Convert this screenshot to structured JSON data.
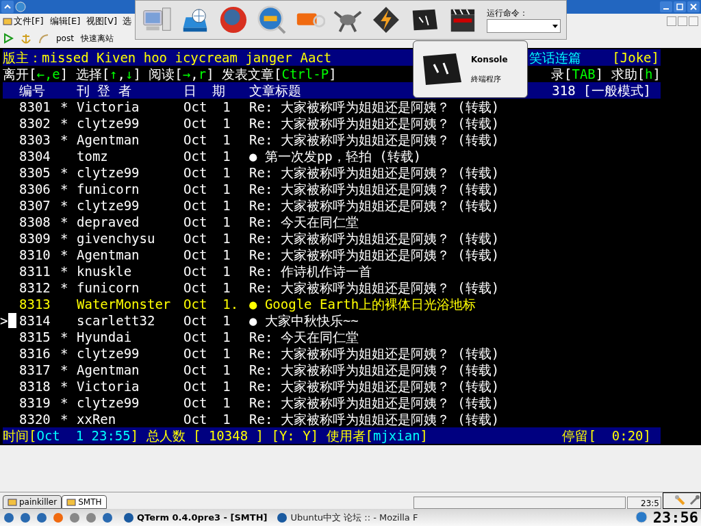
{
  "menu": [
    "文件[F]",
    "编辑[E]",
    "视图[V]",
    "选"
  ],
  "toolbar": [
    "post",
    "快速离站"
  ],
  "launcher": {
    "run_label": "运行命令："
  },
  "tooltip": {
    "title": "Konsole",
    "subtitle": "終端程序"
  },
  "terminal": {
    "cursor": ">",
    "header_left": [
      {
        "text": "版主：missed Kiven hoo icycream janger Aact",
        "kind": "label"
      }
    ],
    "header_right": [
      {
        "text": "笑话连篇",
        "kind": "value"
      },
      {
        "text": "    [Joke]",
        "kind": "label"
      }
    ],
    "help_left": [
      {
        "text": "离开[",
        "kind": "plain"
      },
      {
        "text": "←,e",
        "kind": "key"
      },
      {
        "text": "] 选择[",
        "kind": "plain"
      },
      {
        "text": "↑",
        "kind": "key"
      },
      {
        "text": ",",
        "kind": "plain"
      },
      {
        "text": "↓",
        "kind": "key"
      },
      {
        "text": "] 阅读[",
        "kind": "plain"
      },
      {
        "text": "→",
        "kind": "key"
      },
      {
        "text": ",",
        "kind": "plain"
      },
      {
        "text": "r",
        "kind": "key"
      },
      {
        "text": "] 发表文章[",
        "kind": "plain"
      },
      {
        "text": "Ctrl-P",
        "kind": "key"
      },
      {
        "text": "]",
        "kind": "plain"
      }
    ],
    "help_right": [
      {
        "text": "录[",
        "kind": "plain"
      },
      {
        "text": "TAB",
        "kind": "key"
      },
      {
        "text": "] 求助[",
        "kind": "plain"
      },
      {
        "text": "h",
        "kind": "key"
      },
      {
        "text": "]",
        "kind": "plain"
      }
    ],
    "columns": [
      "编号",
      "刊 登 者",
      "日  期",
      "文章标题"
    ],
    "columns_right": "318 [一般模式]",
    "rows": [
      {
        "number": "8301",
        "mark": "*",
        "author": "Victoria",
        "date": "Oct  1",
        "title": "Re: 大家被称呼为姐姐还是阿姨？ (转载)",
        "highlighted": false,
        "selected": false
      },
      {
        "number": "8302",
        "mark": "*",
        "author": "clytze99",
        "date": "Oct  1",
        "title": "Re: 大家被称呼为姐姐还是阿姨？ (转载)",
        "highlighted": false,
        "selected": false
      },
      {
        "number": "8303",
        "mark": "*",
        "author": "Agentman",
        "date": "Oct  1",
        "title": "Re: 大家被称呼为姐姐还是阿姨？ (转载)",
        "highlighted": false,
        "selected": false
      },
      {
        "number": "8304",
        "mark": "",
        "author": "tomz",
        "date": "Oct  1",
        "title": "● 第一次发pp，轻拍 (转载)",
        "highlighted": false,
        "selected": false
      },
      {
        "number": "8305",
        "mark": "*",
        "author": "clytze99",
        "date": "Oct  1",
        "title": "Re: 大家被称呼为姐姐还是阿姨？ (转载)",
        "highlighted": false,
        "selected": false
      },
      {
        "number": "8306",
        "mark": "*",
        "author": "funicorn",
        "date": "Oct  1",
        "title": "Re: 大家被称呼为姐姐还是阿姨？ (转载)",
        "highlighted": false,
        "selected": false
      },
      {
        "number": "8307",
        "mark": "*",
        "author": "clytze99",
        "date": "Oct  1",
        "title": "Re: 大家被称呼为姐姐还是阿姨？ (转载)",
        "highlighted": false,
        "selected": false
      },
      {
        "number": "8308",
        "mark": "*",
        "author": "depraved",
        "date": "Oct  1",
        "title": "Re: 今天在同仁堂",
        "highlighted": false,
        "selected": false
      },
      {
        "number": "8309",
        "mark": "*",
        "author": "givenchysu",
        "date": "Oct  1",
        "title": "Re: 大家被称呼为姐姐还是阿姨？ (转载)",
        "highlighted": false,
        "selected": false
      },
      {
        "number": "8310",
        "mark": "*",
        "author": "Agentman",
        "date": "Oct  1",
        "title": "Re: 大家被称呼为姐姐还是阿姨？ (转载)",
        "highlighted": false,
        "selected": false
      },
      {
        "number": "8311",
        "mark": "*",
        "author": "knuskle",
        "date": "Oct  1",
        "title": "Re: 作诗机作诗一首",
        "highlighted": false,
        "selected": false
      },
      {
        "number": "8312",
        "mark": "*",
        "author": "funicorn",
        "date": "Oct  1",
        "title": "Re: 大家被称呼为姐姐还是阿姨？ (转载)",
        "highlighted": false,
        "selected": false
      },
      {
        "number": "8313",
        "mark": "",
        "author": "WaterMonster",
        "date": "Oct  1.",
        "title": "● Google Earth上的裸体日光浴地标",
        "highlighted": true,
        "selected": false
      },
      {
        "number": "8314",
        "mark": "",
        "author": "scarlett32",
        "date": "Oct  1",
        "title": "● 大家中秋快乐~~",
        "highlighted": false,
        "selected": true
      },
      {
        "number": "8315",
        "mark": "*",
        "author": "Hyundai",
        "date": "Oct  1",
        "title": "Re: 今天在同仁堂",
        "highlighted": false,
        "selected": false
      },
      {
        "number": "8316",
        "mark": "*",
        "author": "clytze99",
        "date": "Oct  1",
        "title": "Re: 大家被称呼为姐姐还是阿姨？ (转载)",
        "highlighted": false,
        "selected": false
      },
      {
        "number": "8317",
        "mark": "*",
        "author": "Agentman",
        "date": "Oct  1",
        "title": "Re: 大家被称呼为姐姐还是阿姨？ (转载)",
        "highlighted": false,
        "selected": false
      },
      {
        "number": "8318",
        "mark": "*",
        "author": "Victoria",
        "date": "Oct  1",
        "title": "Re: 大家被称呼为姐姐还是阿姨？ (转载)",
        "highlighted": false,
        "selected": false
      },
      {
        "number": "8319",
        "mark": "*",
        "author": "clytze99",
        "date": "Oct  1",
        "title": "Re: 大家被称呼为姐姐还是阿姨？ (转载)",
        "highlighted": false,
        "selected": false
      },
      {
        "number": "8320",
        "mark": "*",
        "author": "xxRen",
        "date": "Oct  1",
        "title": "Re: 大家被称呼为姐姐还是阿姨？ (转载)",
        "highlighted": false,
        "selected": false
      }
    ],
    "status_left": [
      {
        "text": "时间[",
        "kind": "label"
      },
      {
        "text": "Oct  1 23:55",
        "kind": "value"
      },
      {
        "text": "] 总人数 [ 10348 ] [Y: Y] 使用者[",
        "kind": "label"
      },
      {
        "text": "mjxian",
        "kind": "value"
      },
      {
        "text": "]",
        "kind": "label"
      }
    ],
    "status_right": [
      {
        "text": "停留[  0:20]",
        "kind": "label"
      }
    ]
  },
  "tabs": [
    {
      "label": "painkiller",
      "selected": false
    },
    {
      "label": "SMTH",
      "selected": true
    }
  ],
  "status_bar": {
    "time": "23:5"
  },
  "taskbar": {
    "tasks": [
      {
        "label": "QTerm 0.4.0pre3 - [SMTH]",
        "selected": true
      },
      {
        "label": "Ubuntu中文 论坛 :: - Mozilla F",
        "selected": false
      }
    ],
    "clock": "23:56"
  }
}
